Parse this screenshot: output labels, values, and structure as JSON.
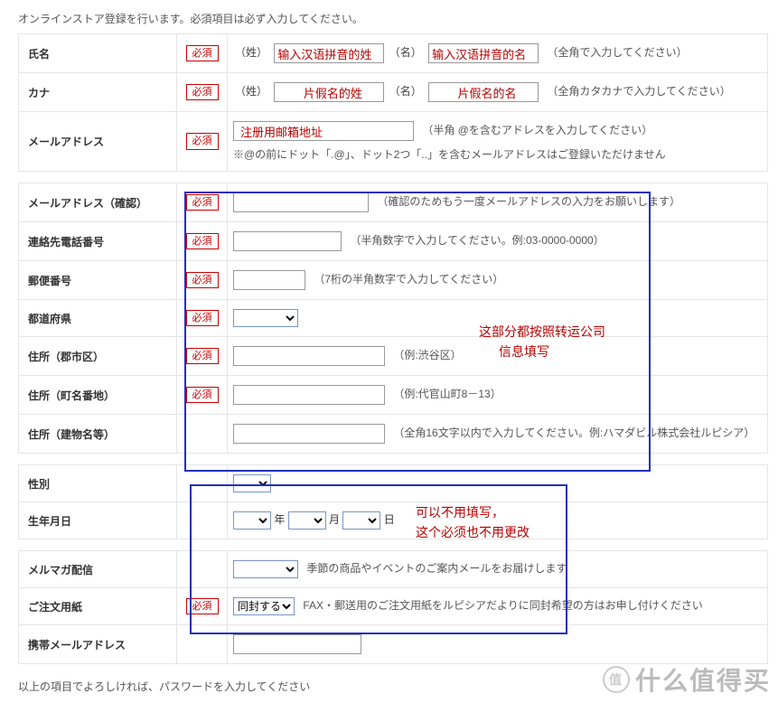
{
  "intro": "オンラインストア登録を行います。必須項目は必ず入力してください。",
  "req_label": "必須",
  "labels": {
    "name": "氏名",
    "kana": "カナ",
    "email": "メールアドレス",
    "email_confirm": "メールアドレス（確認）",
    "phone": "連絡先電話番号",
    "postal": "郵便番号",
    "pref": "都道府県",
    "addr_city": "住所（郡市区）",
    "addr_town": "住所（町名番地）",
    "addr_bldg": "住所（建物名等）",
    "gender": "性別",
    "birth": "生年月日",
    "mailmag": "メルマガ配信",
    "order_paper": "ご注文用紙",
    "mobile_mail": "携帯メールアドレス"
  },
  "pfx": {
    "sei_kanji": "（姓）",
    "mei_kanji": "（名）",
    "sei_kana": "（姓）",
    "mei_kana": "（名）"
  },
  "hints": {
    "name": "（全角で入力してください）",
    "kana": "（全角カタカナで入力してください）",
    "email": "（半角  @を含むアドレスを入力してください）",
    "email_note": "※@の前にドット「.@」、ドット2つ「..」を含むメールアドレスはご登録いただけません",
    "email_confirm": "（確認のためもう一度メールアドレスの入力をお願いします）",
    "phone": "（半角数字で入力してください。例:03-0000-0000）",
    "postal": "（7桁の半角数字で入力してください）",
    "addr_city": "（例:渋谷区）",
    "addr_town": "（例:代官山町8－13）",
    "addr_bldg": "（全角16文字以内で入力してください。例:ハマダビル株式会社ルピシア）",
    "mailmag": "季節の商品やイベントのご案内メールをお届けします",
    "order_paper": "FAX・郵送用のご注文用紙をルピシアだよりに同封希望の方はお申し付けください"
  },
  "birth_units": {
    "y": "年",
    "m": "月",
    "d": "日"
  },
  "order_paper_value": "同封する",
  "annotations": {
    "name_sei": "输入汉语拼音的姓",
    "name_mei": "输入汉语拼音的名",
    "kana_sei": "片假名的姓",
    "kana_mei": "片假名的名",
    "email": "注册用邮箱地址",
    "section_forward_1": "这部分都按照转运公司",
    "section_forward_2": "信息填写",
    "optional_1": "可以不用填写，",
    "optional_2": "这个必须也不用更改"
  },
  "watermark": {
    "circle": "值",
    "text": "什么值得买"
  },
  "footer": "以上の項目でよろしければ、パスワードを入力してください"
}
